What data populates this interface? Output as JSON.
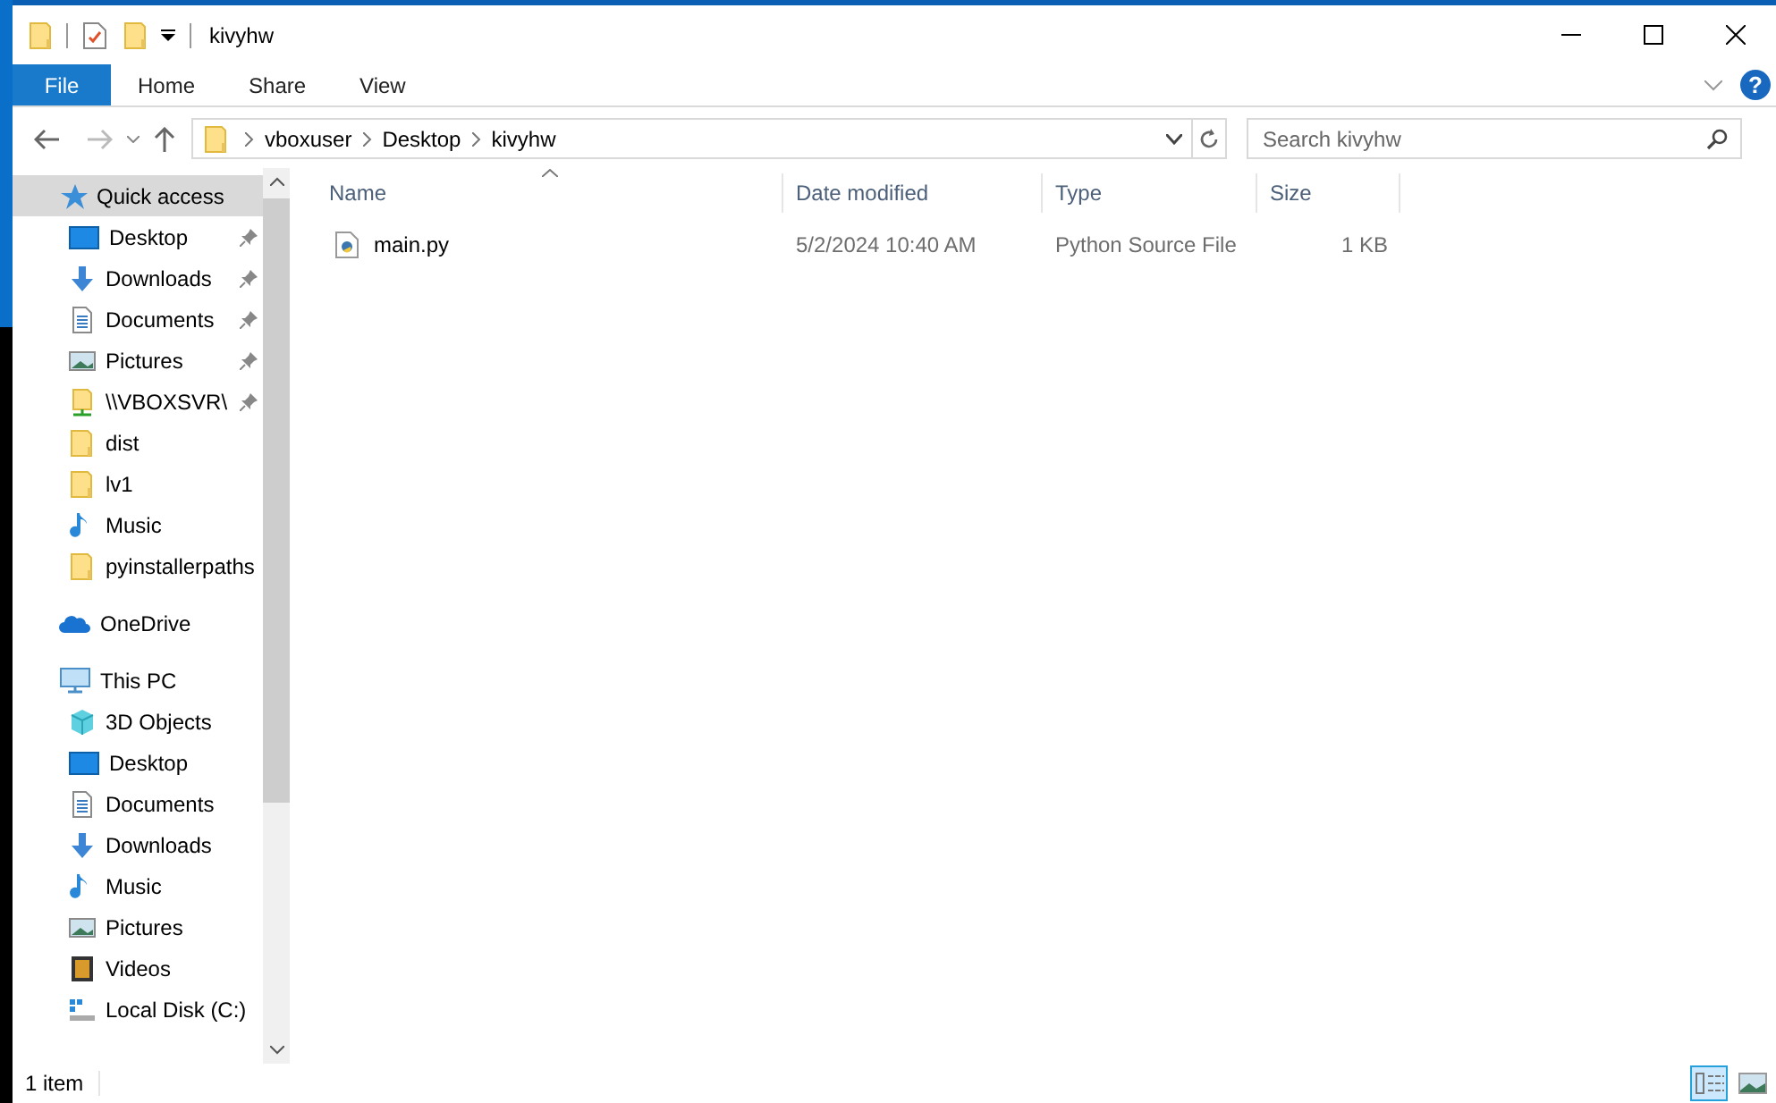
{
  "window": {
    "title": "kivyhw"
  },
  "ribbon_tabs": [
    {
      "label": "File",
      "kind": "menu",
      "selected": false
    },
    {
      "label": "Home",
      "kind": "tab",
      "selected": false
    },
    {
      "label": "Share",
      "kind": "tab",
      "selected": false
    },
    {
      "label": "View",
      "kind": "tab",
      "selected": false
    }
  ],
  "help_button": {
    "label": "?"
  },
  "address_bar": {
    "path": [
      "vboxuser",
      "Desktop",
      "kivyhw"
    ]
  },
  "search": {
    "placeholder": "Search kivyhw"
  },
  "nav": [
    {
      "label": "Quick access",
      "kind": "star",
      "selected": true,
      "children": [
        {
          "label": "Desktop",
          "kind": "desktop",
          "pinned": true,
          "selected": false
        },
        {
          "label": "Downloads",
          "kind": "downloads",
          "pinned": true,
          "selected": false
        },
        {
          "label": "Documents",
          "kind": "documents",
          "pinned": true,
          "selected": false
        },
        {
          "label": "Pictures",
          "kind": "pictures",
          "pinned": true,
          "selected": false
        },
        {
          "label": "\\\\VBOXSVR\\",
          "kind": "network",
          "pinned": true,
          "selected": false
        },
        {
          "label": "dist",
          "kind": "folder",
          "pinned": false,
          "selected": false
        },
        {
          "label": "lv1",
          "kind": "folder",
          "pinned": false,
          "selected": false
        },
        {
          "label": "Music",
          "kind": "music",
          "pinned": false,
          "selected": false
        },
        {
          "label": "pyinstallerpaths",
          "kind": "folder",
          "pinned": false,
          "selected": false
        }
      ]
    },
    {
      "label": "OneDrive",
      "kind": "cloud",
      "selected": false
    },
    {
      "label": "This PC",
      "kind": "pc",
      "selected": false,
      "children": [
        {
          "label": "3D Objects",
          "kind": "cube",
          "pinned": false,
          "selected": false
        },
        {
          "label": "Desktop",
          "kind": "desktop",
          "pinned": false,
          "selected": false
        },
        {
          "label": "Documents",
          "kind": "documents",
          "pinned": false,
          "selected": false
        },
        {
          "label": "Downloads",
          "kind": "downloads",
          "pinned": false,
          "selected": false
        },
        {
          "label": "Music",
          "kind": "music",
          "pinned": false,
          "selected": false
        },
        {
          "label": "Pictures",
          "kind": "pictures",
          "pinned": false,
          "selected": false
        },
        {
          "label": "Videos",
          "kind": "videos",
          "pinned": false,
          "selected": false
        },
        {
          "label": "Local Disk (C:)",
          "kind": "drive",
          "pinned": false,
          "selected": false
        }
      ]
    }
  ],
  "table": {
    "columns": [
      {
        "label": "Name",
        "sorted": true
      },
      {
        "label": "Date modified",
        "sorted": false
      },
      {
        "label": "Type",
        "sorted": false
      },
      {
        "label": "Size",
        "sorted": false
      }
    ],
    "rows": [
      {
        "name": "main.py",
        "date_modified": "5/2/2024 10:40 AM",
        "type": "Python Source File",
        "size": "1 KB",
        "selected": false
      }
    ]
  },
  "status_bar": {
    "item_count": "1 item",
    "views": [
      {
        "kind": "details",
        "selected": true
      },
      {
        "kind": "large-icons",
        "selected": false
      }
    ]
  }
}
